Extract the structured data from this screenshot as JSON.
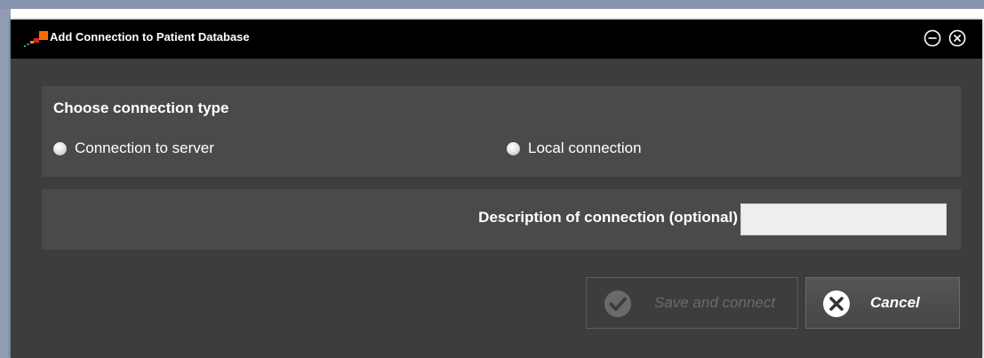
{
  "window": {
    "title": "Add Connection to Patient Database",
    "logo_icon": "app-logo-icon",
    "minimize_icon": "minimize-icon",
    "close_icon": "close-icon"
  },
  "connection_type": {
    "heading": "Choose connection type",
    "options": [
      {
        "label": "Connection to server",
        "selected": false
      },
      {
        "label": "Local connection",
        "selected": false
      }
    ]
  },
  "description": {
    "label": "Description of connection (optional)",
    "value": "",
    "placeholder": ""
  },
  "buttons": {
    "save": {
      "label": "Save and connect",
      "enabled": false,
      "icon": "checkmark-icon"
    },
    "cancel": {
      "label": "Cancel",
      "enabled": true,
      "icon": "cancel-x-icon"
    }
  },
  "colors": {
    "dialog_background": "#3d3d3d",
    "panel_background": "#4a4a4a",
    "titlebar_background": "#000000",
    "logo_orange": "#ff6a00",
    "logo_red": "#d42a1e"
  }
}
